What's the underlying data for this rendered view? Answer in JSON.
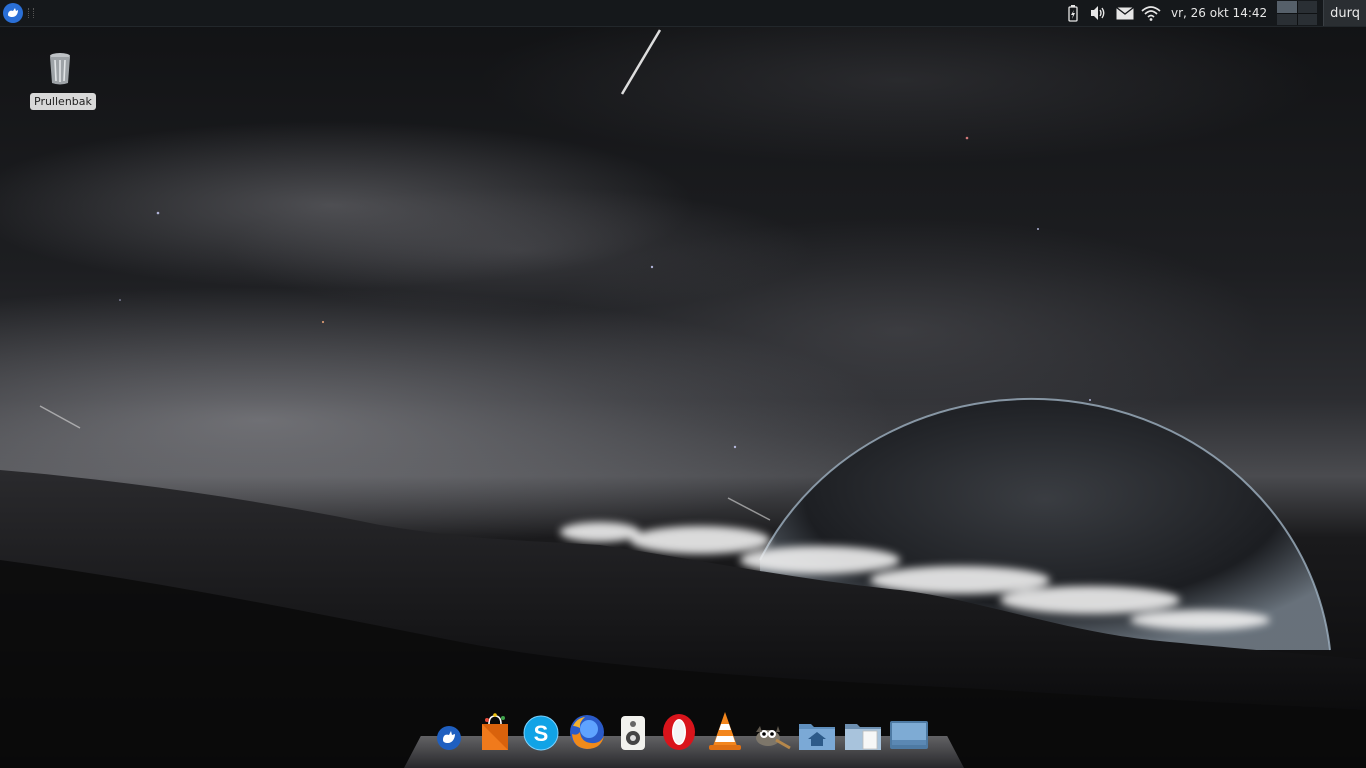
{
  "top_panel": {
    "app_menu_icon": "xfce-mouse-icon",
    "tray_icons": [
      "battery-icon",
      "volume-icon",
      "mail-icon",
      "wifi-icon"
    ],
    "clock": "vr, 26 okt  14:42",
    "workspaces": 4,
    "active_workspace": 1,
    "user": "durq"
  },
  "desktop": {
    "icons": [
      {
        "label": "Prullenbak",
        "icon": "trash-icon"
      }
    ]
  },
  "dock": {
    "items": [
      {
        "name": "xfce-menu",
        "icon": "xfce-mouse-icon"
      },
      {
        "name": "software-center",
        "icon": "shopping-bag-icon"
      },
      {
        "name": "skype",
        "icon": "skype-icon"
      },
      {
        "name": "firefox",
        "icon": "firefox-icon"
      },
      {
        "name": "speaker-app",
        "icon": "speaker-icon"
      },
      {
        "name": "opera",
        "icon": "opera-icon"
      },
      {
        "name": "vlc",
        "icon": "vlc-cone-icon"
      },
      {
        "name": "gimp",
        "icon": "gimp-icon"
      },
      {
        "name": "home-folder",
        "icon": "home-folder-icon"
      },
      {
        "name": "files",
        "icon": "files-icon"
      },
      {
        "name": "desktop-folder",
        "icon": "desktop-folder-icon"
      }
    ]
  },
  "colors": {
    "panel_bg": "#15181b",
    "accent_blue": "#2a6fd6"
  }
}
